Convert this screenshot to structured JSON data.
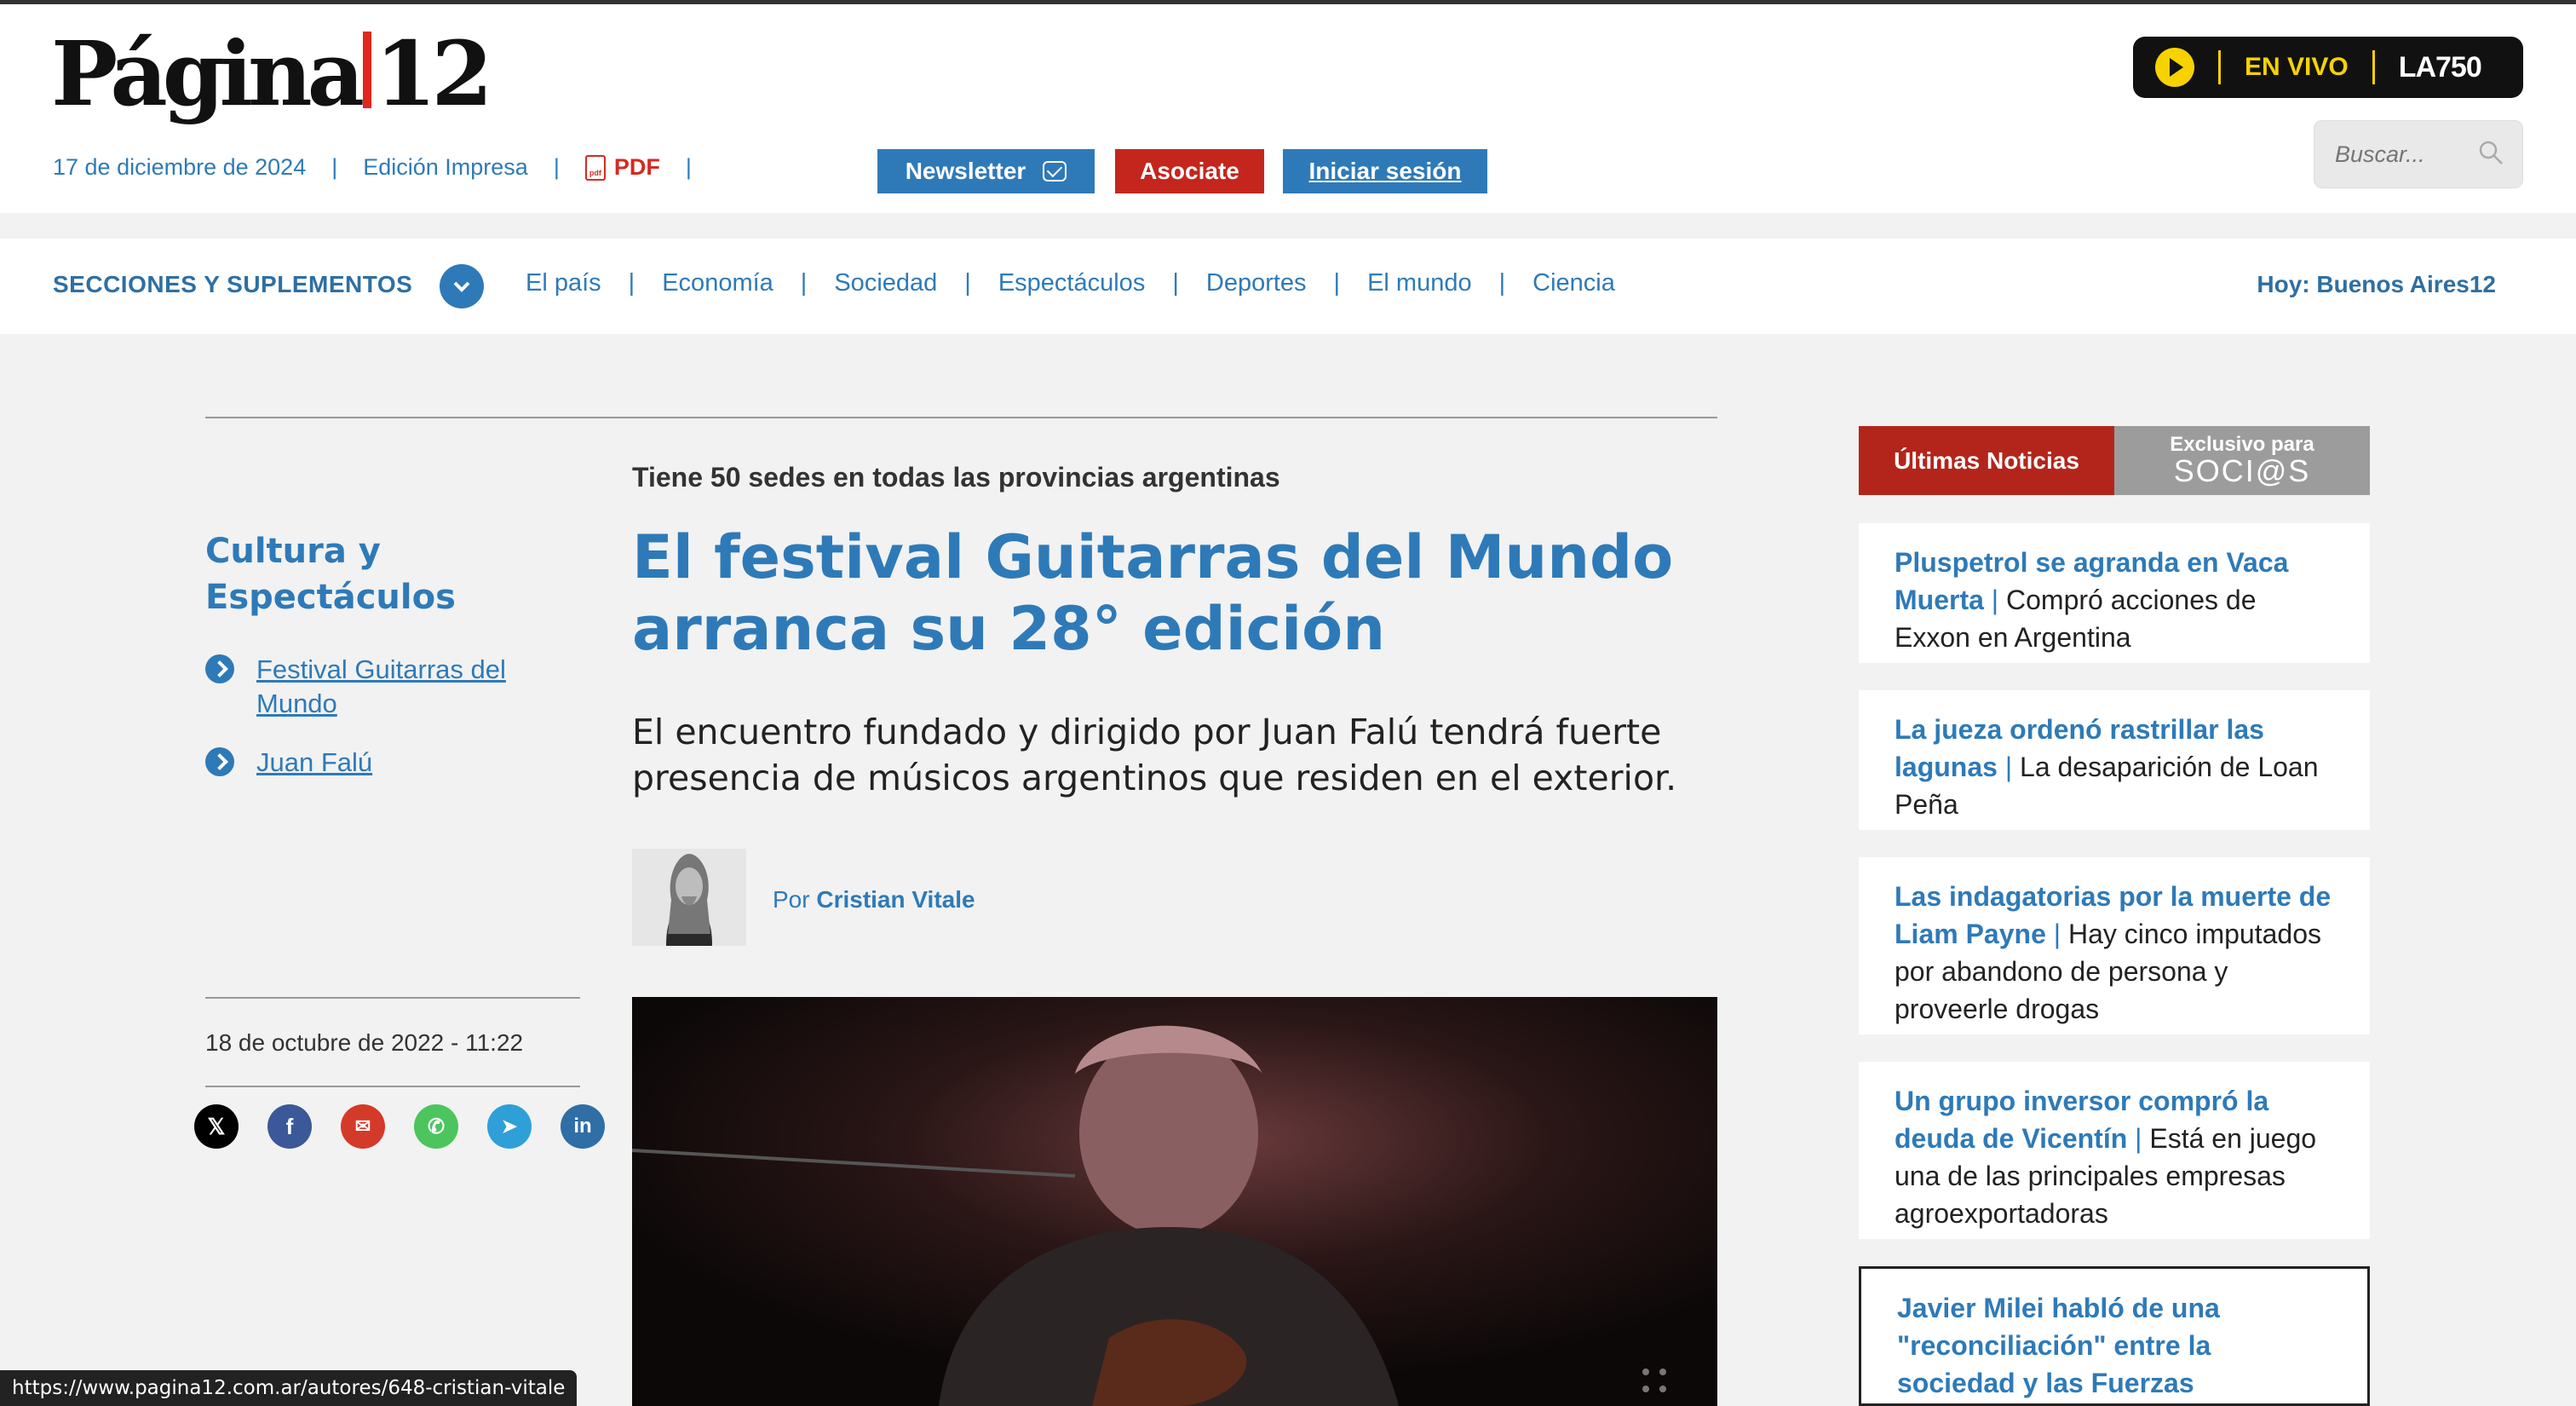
{
  "header": {
    "logo_text": "Página12",
    "date": "17 de diciembre de 2024",
    "edicion": "Edición Impresa",
    "pdf": "PDF",
    "newsletter": "Newsletter",
    "asociate": "Asociate",
    "login": "Iniciar sesión",
    "envivo": "EN VIVO",
    "radio": "LA750",
    "search_placeholder": "Buscar..."
  },
  "nav": {
    "title": "SECCIONES Y SUPLEMENTOS",
    "links": [
      "El país",
      "Economía",
      "Sociedad",
      "Espectáculos",
      "Deportes",
      "El mundo",
      "Ciencia"
    ],
    "right": "Hoy: Buenos Aires12"
  },
  "sidebar": {
    "section": "Cultura y Espectáculos",
    "tags": [
      "Festival Guitarras del Mundo",
      "Juan Falú"
    ],
    "date": "18 de octubre de 2022 - 11:22"
  },
  "article": {
    "kicker": "Tiene 50 sedes en todas las provincias argentinas",
    "headline": "El festival Guitarras del Mundo arranca su 28° edición",
    "lede": "El encuentro fundado y dirigido por Juan Falú tendrá fuerte presencia de músicos argentinos que residen en el exterior.",
    "by": "Por",
    "author": "Cristian Vitale"
  },
  "right_column": {
    "tab_latest": "Últimas Noticias",
    "tab_exclusive_1": "Exclusivo para",
    "tab_exclusive_2": "SOCI@S",
    "news": [
      {
        "headline": "Pluspetrol se agranda en Vaca Muerta",
        "summary": "Compró acciones de Exxon en Argentina"
      },
      {
        "headline": "La jueza ordenó rastrillar las lagunas",
        "summary": "La desaparición de Loan Peña"
      },
      {
        "headline": "Las indagatorias por la muerte de Liam Payne",
        "summary": "Hay cinco imputados por abandono de persona y proveerle drogas"
      },
      {
        "headline": "Un grupo inversor compró la deuda de Vicentín",
        "summary": "Está en juego una de las principales empresas agroexportadoras"
      },
      {
        "headline": "Javier Milei habló de una \"reconciliación\" entre la sociedad y las Fuerzas"
      }
    ]
  },
  "status_url": "https://www.pagina12.com.ar/autores/648-cristian-vitale",
  "colors": {
    "brand_blue": "#2e7ab8",
    "brand_red": "#c4261d",
    "live_yellow": "#f7d200"
  }
}
